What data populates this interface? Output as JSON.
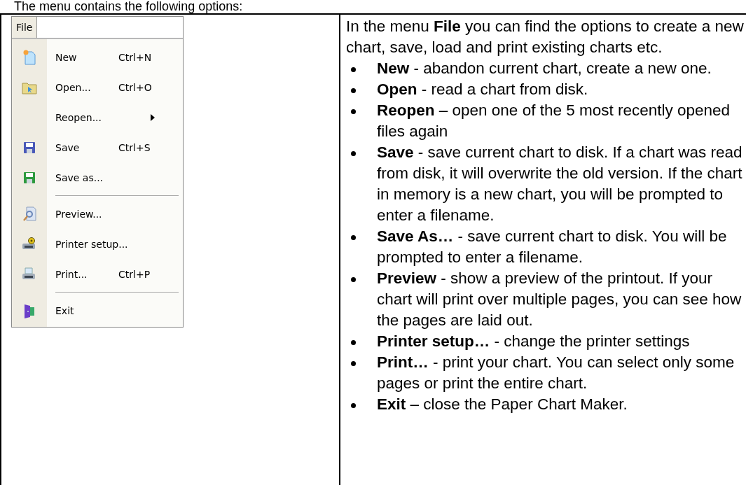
{
  "caption": "The menu contains the following options:",
  "menu": {
    "bar_label": "File",
    "items": [
      {
        "kind": "item",
        "label": "New",
        "shortcut": "Ctrl+N",
        "submenu": false
      },
      {
        "kind": "item",
        "label": "Open...",
        "shortcut": "Ctrl+O",
        "submenu": false
      },
      {
        "kind": "item",
        "label": "Reopen...",
        "submenu": true
      },
      {
        "kind": "item",
        "label": "Save",
        "shortcut": "Ctrl+S",
        "submenu": false
      },
      {
        "kind": "item",
        "label": "Save as...",
        "submenu": false
      },
      {
        "kind": "separator"
      },
      {
        "kind": "item",
        "label": "Preview...",
        "submenu": false
      },
      {
        "kind": "item",
        "label": "Printer setup...",
        "submenu": false
      },
      {
        "kind": "item",
        "label": "Print...",
        "shortcut": "Ctrl+P",
        "submenu": false
      },
      {
        "kind": "separator"
      },
      {
        "kind": "item",
        "label": "Exit",
        "submenu": false
      }
    ]
  },
  "description": {
    "intro": "In the menu **File** you can find the options to create a new chart, save, load and print existing charts etc.",
    "bullets": [
      "**New** - abandon current chart, create a new one.",
      "**Open** - read a chart from disk.",
      "**Reopen** – open one of the 5 most recently opened files again",
      "**Save** - save current chart to disk. If a chart was read from disk, it will overwrite the old version. If the chart in memory is a new chart, you will be prompted to enter a filename.",
      "**Save As…** - save current chart to disk. You will be prompted to enter a filename.",
      "**Preview** - show a preview of the printout. If your chart will print over multiple pages, you can see how the pages are laid out.",
      "**Printer setup…** - change the printer settings",
      "**Print…** - print your chart. You can select only some pages or print the entire chart.",
      "**Exit** – close the Paper Chart Maker."
    ]
  }
}
